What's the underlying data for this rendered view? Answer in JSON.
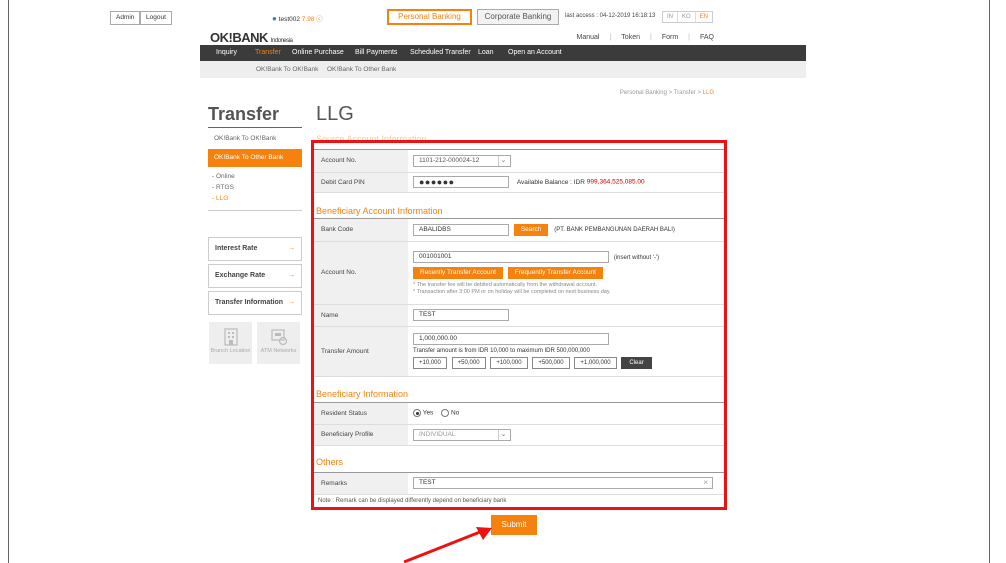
{
  "top": {
    "admin": "Admin",
    "logout": "Logout",
    "user": "test002",
    "points": "7.98",
    "tab_personal": "Personal Banking",
    "tab_corporate": "Corporate Banking",
    "last_access": "last access : 04-12-2019 16:18:13",
    "lang": [
      "IN",
      "KO",
      "EN"
    ]
  },
  "logo": {
    "name": "OK!BANK",
    "region": "Indonesia"
  },
  "top_links": [
    "Manual",
    "Token",
    "Form",
    "FAQ"
  ],
  "nav": [
    "Inquiry",
    "Transfer",
    "Online Purchase",
    "Bill Payments",
    "Scheduled Transfer",
    "Loan",
    "Open an Account"
  ],
  "subnav": [
    "OK!Bank To OK!Bank",
    "OK!Bank To Other Bank"
  ],
  "breadcrumb": {
    "a": "Personal Banking",
    "b": "Transfer",
    "c": "LLG",
    "sep": ">"
  },
  "sidebar": {
    "title": "Transfer",
    "link1": "OK!Bank To OK!Bank",
    "active": "OK!Bank To Other Bank",
    "subs": [
      "- Online",
      "- RTGS",
      "- LLG"
    ],
    "boxes": [
      "Interest Rate",
      "Exchange Rate",
      "Transfer Information"
    ],
    "tiles": [
      "Branch Location",
      "ATM Networks"
    ]
  },
  "main": {
    "title": "LLG",
    "sections": {
      "source": "Source Account Information",
      "beneficiary_account": "Beneficiary Account Information",
      "beneficiary_info": "Beneficiary Information",
      "others": "Others"
    },
    "account_no_label": "Account No.",
    "account_no_value": "1101-212-000024-12",
    "pin_label": "Debit Card PIN",
    "pin_value": "●●●●●●",
    "balance_label": "Available Balance : IDR",
    "balance_value": "999,364,525,085.00",
    "bank_code_label": "Bank Code",
    "bank_code_value": "ABALIDBS",
    "search_btn": "Search",
    "bank_name": "(PT. BANK PEMBANGUNAN DAERAH BALI)",
    "ben_account_label": "Account No.",
    "ben_account_value": "001001001",
    "insert_hint": "(insert without '-')",
    "recent_btn": "Recently Transfer Account",
    "freq_btn": "Frequently Transfer Account",
    "note1": "* The transfer fee will be debited automatically from the withdrawal account.",
    "note2": "* Transaction after 3:00 PM or on holiday will be completed on next business day.",
    "name_label": "Name",
    "name_value": "TEST",
    "amount_label": "Transfer Amount",
    "amount_value": "1,000,000.00",
    "amount_hint": "Transfer amount is from IDR 10,000 to maximum IDR 500,000,000",
    "amount_btns": [
      "+10,000",
      "+50,000",
      "+100,000",
      "+500,000",
      "+1,000,000"
    ],
    "clear_btn": "Clear",
    "resident_label": "Resident Status",
    "resident_yes": "Yes",
    "resident_no": "No",
    "profile_label": "Beneficiary Profile",
    "profile_value": "INDIVIDUAL",
    "remarks_label": "Remarks",
    "remarks_value": "TEST",
    "remark_note": "Note : Remark can be displayed differently depend on beneficiary bank",
    "submit": "Submit"
  },
  "colors": {
    "accent": "#f5820e",
    "highlight": "#ee1111",
    "nav_bg": "#3b3b3b"
  }
}
